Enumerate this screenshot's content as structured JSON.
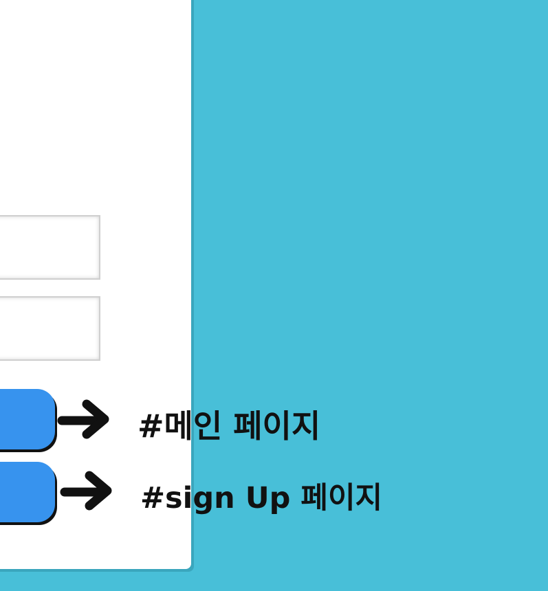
{
  "form": {
    "id_value": "",
    "pw_value": "",
    "login_label": "",
    "signup_label": ""
  },
  "annotations": {
    "main_page": "#메인 페이지",
    "signup_page": "#sign Up 페이지"
  },
  "colors": {
    "background": "#48bfd8",
    "card": "#ffffff",
    "button": "#3793ee",
    "annotation": "#111111"
  },
  "icons": {
    "arrow": "arrow-right-icon"
  }
}
